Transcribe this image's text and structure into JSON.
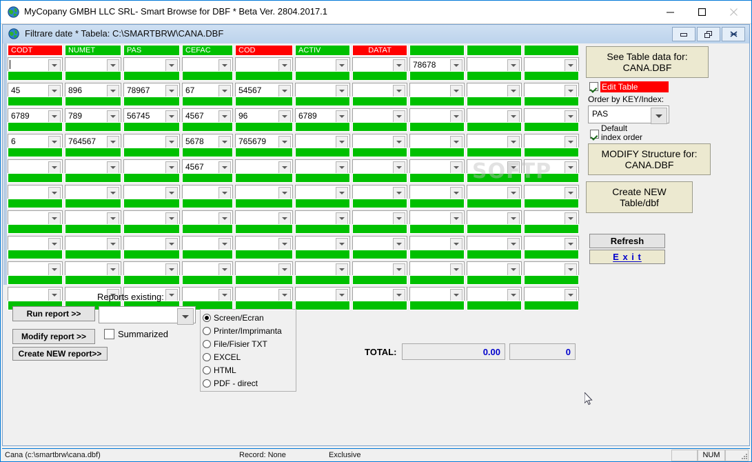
{
  "window": {
    "title": "MyCopany GMBH LLC SRL- Smart Browse for DBF * Beta Ver. 2804.2017.1",
    "icon": "globe-icon",
    "minimize_label": "—",
    "maximize_label": "☐",
    "close_label": "✕"
  },
  "child_window": {
    "title": "Filtrare date * Tabela: C:\\SMARTBRW\\CANA.DBF",
    "icon": "globe-icon",
    "minimize_label": "restore-down-icon",
    "restore_label": "restore-icon",
    "close_label": "close-icon"
  },
  "grid": {
    "columns": [
      {
        "name": "CODT",
        "color": "#ff0000",
        "align": "left"
      },
      {
        "name": "NUMET",
        "color": "#00c000",
        "align": "left"
      },
      {
        "name": "PAS",
        "color": "#00c000",
        "align": "left"
      },
      {
        "name": "CEFAC",
        "color": "#00c000",
        "align": "left"
      },
      {
        "name": "COD",
        "color": "#ff0000",
        "align": "left"
      },
      {
        "name": "ACTIV",
        "color": "#00c000",
        "align": "left"
      },
      {
        "name": "DATAT",
        "color": "#ff0000",
        "align": "center"
      },
      {
        "name": "",
        "color": "#00c000",
        "align": "left"
      },
      {
        "name": "",
        "color": "#00c000",
        "align": "left"
      },
      {
        "name": "",
        "color": "#00c000",
        "align": "left"
      }
    ],
    "rows": [
      [
        "",
        "",
        "",
        "",
        "",
        "",
        "",
        "78678",
        "",
        ""
      ],
      [
        "45",
        "896",
        "78967",
        "67",
        "54567",
        "",
        "",
        "",
        "",
        ""
      ],
      [
        "6789",
        "789",
        "56745",
        "4567",
        "96",
        "6789",
        "",
        "",
        "",
        ""
      ],
      [
        "6",
        "764567",
        "",
        "5678",
        "765679",
        "",
        "",
        "",
        "",
        ""
      ],
      [
        "",
        "",
        "",
        "4567",
        "",
        "",
        "",
        "",
        "",
        ""
      ],
      [
        "",
        "",
        "",
        "",
        "",
        "",
        "",
        "",
        "",
        ""
      ],
      [
        "",
        "",
        "",
        "",
        "",
        "",
        "",
        "",
        "",
        ""
      ],
      [
        "",
        "",
        "",
        "",
        "",
        "",
        "",
        "",
        "",
        ""
      ],
      [
        "",
        "",
        "",
        "",
        "",
        "",
        "",
        "",
        "",
        ""
      ],
      [
        "",
        "",
        "",
        "",
        "",
        "",
        "",
        "",
        "",
        ""
      ]
    ],
    "active_cell": {
      "row": 0,
      "col": 0
    },
    "watermark": "SOFTP"
  },
  "right_panel": {
    "see_table_line1": "See Table data for:",
    "see_table_line2": "CANA.DBF",
    "edit_table_label": "Edit Table",
    "edit_table_checked": true,
    "edit_table_bg": "#ff0000",
    "order_by_label": "Order by  KEY/Index:",
    "index_value": "PAS",
    "default_line1": "Default",
    "default_line2": "index order",
    "default_checked": true,
    "modify_line1": "MODIFY Structure for:",
    "modify_line2": "CANA.DBF",
    "create_line1": "Create NEW",
    "create_line2": "Table/dbf",
    "refresh_label": "Refresh",
    "exit_label": "E x i t",
    "exit_color": "#0000cc"
  },
  "reports": {
    "existing_label": "Reports existing:",
    "run_label": "Run report >>",
    "modify_label": "Modify report >>",
    "create_label": "Create NEW report>>",
    "combo_value": "",
    "summarized_label": "Summarized",
    "summarized_checked": false,
    "output_options": [
      {
        "label": "Screen/Ecran",
        "selected": true
      },
      {
        "label": "Printer/Imprimanta",
        "selected": false
      },
      {
        "label": "File/Fisier TXT",
        "selected": false
      },
      {
        "label": "EXCEL",
        "selected": false
      },
      {
        "label": "HTML",
        "selected": false
      },
      {
        "label": "PDF - direct",
        "selected": false
      }
    ]
  },
  "totals": {
    "label": "TOTAL:",
    "amount": "0.00",
    "count": "0"
  },
  "statusbar": {
    "file": "Cana (c:\\smartbrw\\cana.dbf)",
    "record": "Record: None",
    "mode": "Exclusive",
    "num_indicator": "NUM"
  }
}
